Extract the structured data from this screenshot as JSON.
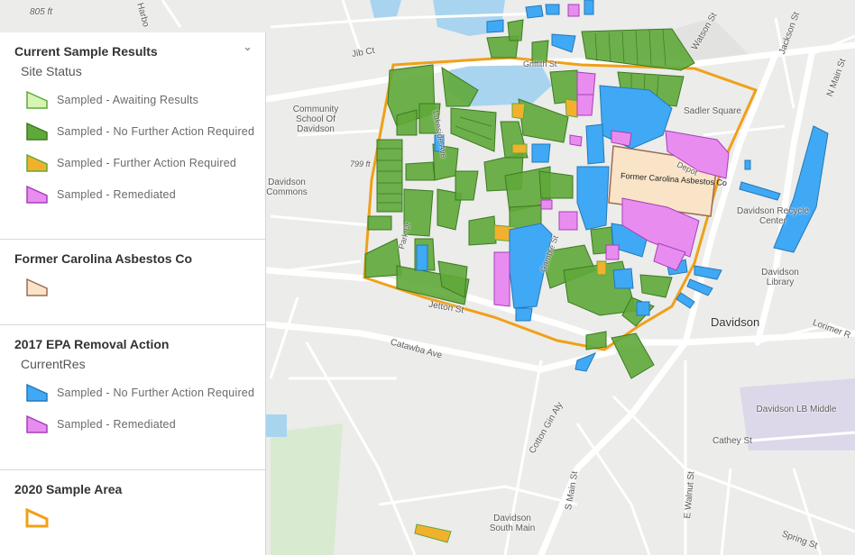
{
  "legend": {
    "sections": [
      {
        "title": "Current Sample Results",
        "subtitle": "Site Status",
        "items": [
          {
            "label": "Sampled - Awaiting Results",
            "fill": "#d6f5b5",
            "stroke": "#5fa83a"
          },
          {
            "label": "Sampled - No Further Action Required",
            "fill": "#5fa83a",
            "stroke": "#3c7a22"
          },
          {
            "label": "Sampled - Further Action Required",
            "fill": "#f2b12c",
            "stroke": "#5fa83a"
          },
          {
            "label": "Sampled - Remediated",
            "fill": "#e98cf0",
            "stroke": "#a63fb8"
          }
        ]
      },
      {
        "title": "Former Carolina Asbestos Co",
        "items": [
          {
            "label": "",
            "fill": "#f9e4c8",
            "stroke": "#9b6b55"
          }
        ]
      },
      {
        "title": "2017 EPA Removal Action",
        "subtitle": "CurrentRes",
        "items": [
          {
            "label": "Sampled - No Further Action Required",
            "fill": "#3fa9f5",
            "stroke": "#2478b8"
          },
          {
            "label": "Sampled - Remediated",
            "fill": "#e98cf0",
            "stroke": "#a63fb8"
          }
        ]
      },
      {
        "title": "2020 Sample Area",
        "items": [
          {
            "label": "",
            "fill": "none",
            "stroke": "#f0a018"
          }
        ]
      }
    ]
  },
  "map": {
    "labels": {
      "ft805": "805 ft",
      "harbor": "Harbo",
      "jib": "Jib Ct",
      "griffith": "Griffith St",
      "watson": "Watson St",
      "jackson": "Jackson St",
      "nmain": "N Main St",
      "sadler": "Sadler Square",
      "community": "Community School Of Davidson",
      "ft799": "799 ft",
      "lakeside": "Lakeside Ave",
      "former": "Former Carolina Asbestos Co",
      "depot": "Depot",
      "davidson_commons": "Davidson Commons",
      "recycle": "Davidson Recycle Center",
      "library": "Davidson Library",
      "davidson": "Davidson",
      "park": "Park Dr",
      "jetton": "Jetton St",
      "catawba": "Catawba Ave",
      "gamble": "Gamble St",
      "lorimer": "Lorimer R",
      "lb_middle": "Davidson LB Middle",
      "cotton": "Cotton Gin Aly",
      "cathey": "Cathey St",
      "smain": "S Main St",
      "ewalnut": "E Walnut St",
      "south_main": "Davidson South Main",
      "spring": "Spring St",
      "rd": "Rd"
    }
  }
}
